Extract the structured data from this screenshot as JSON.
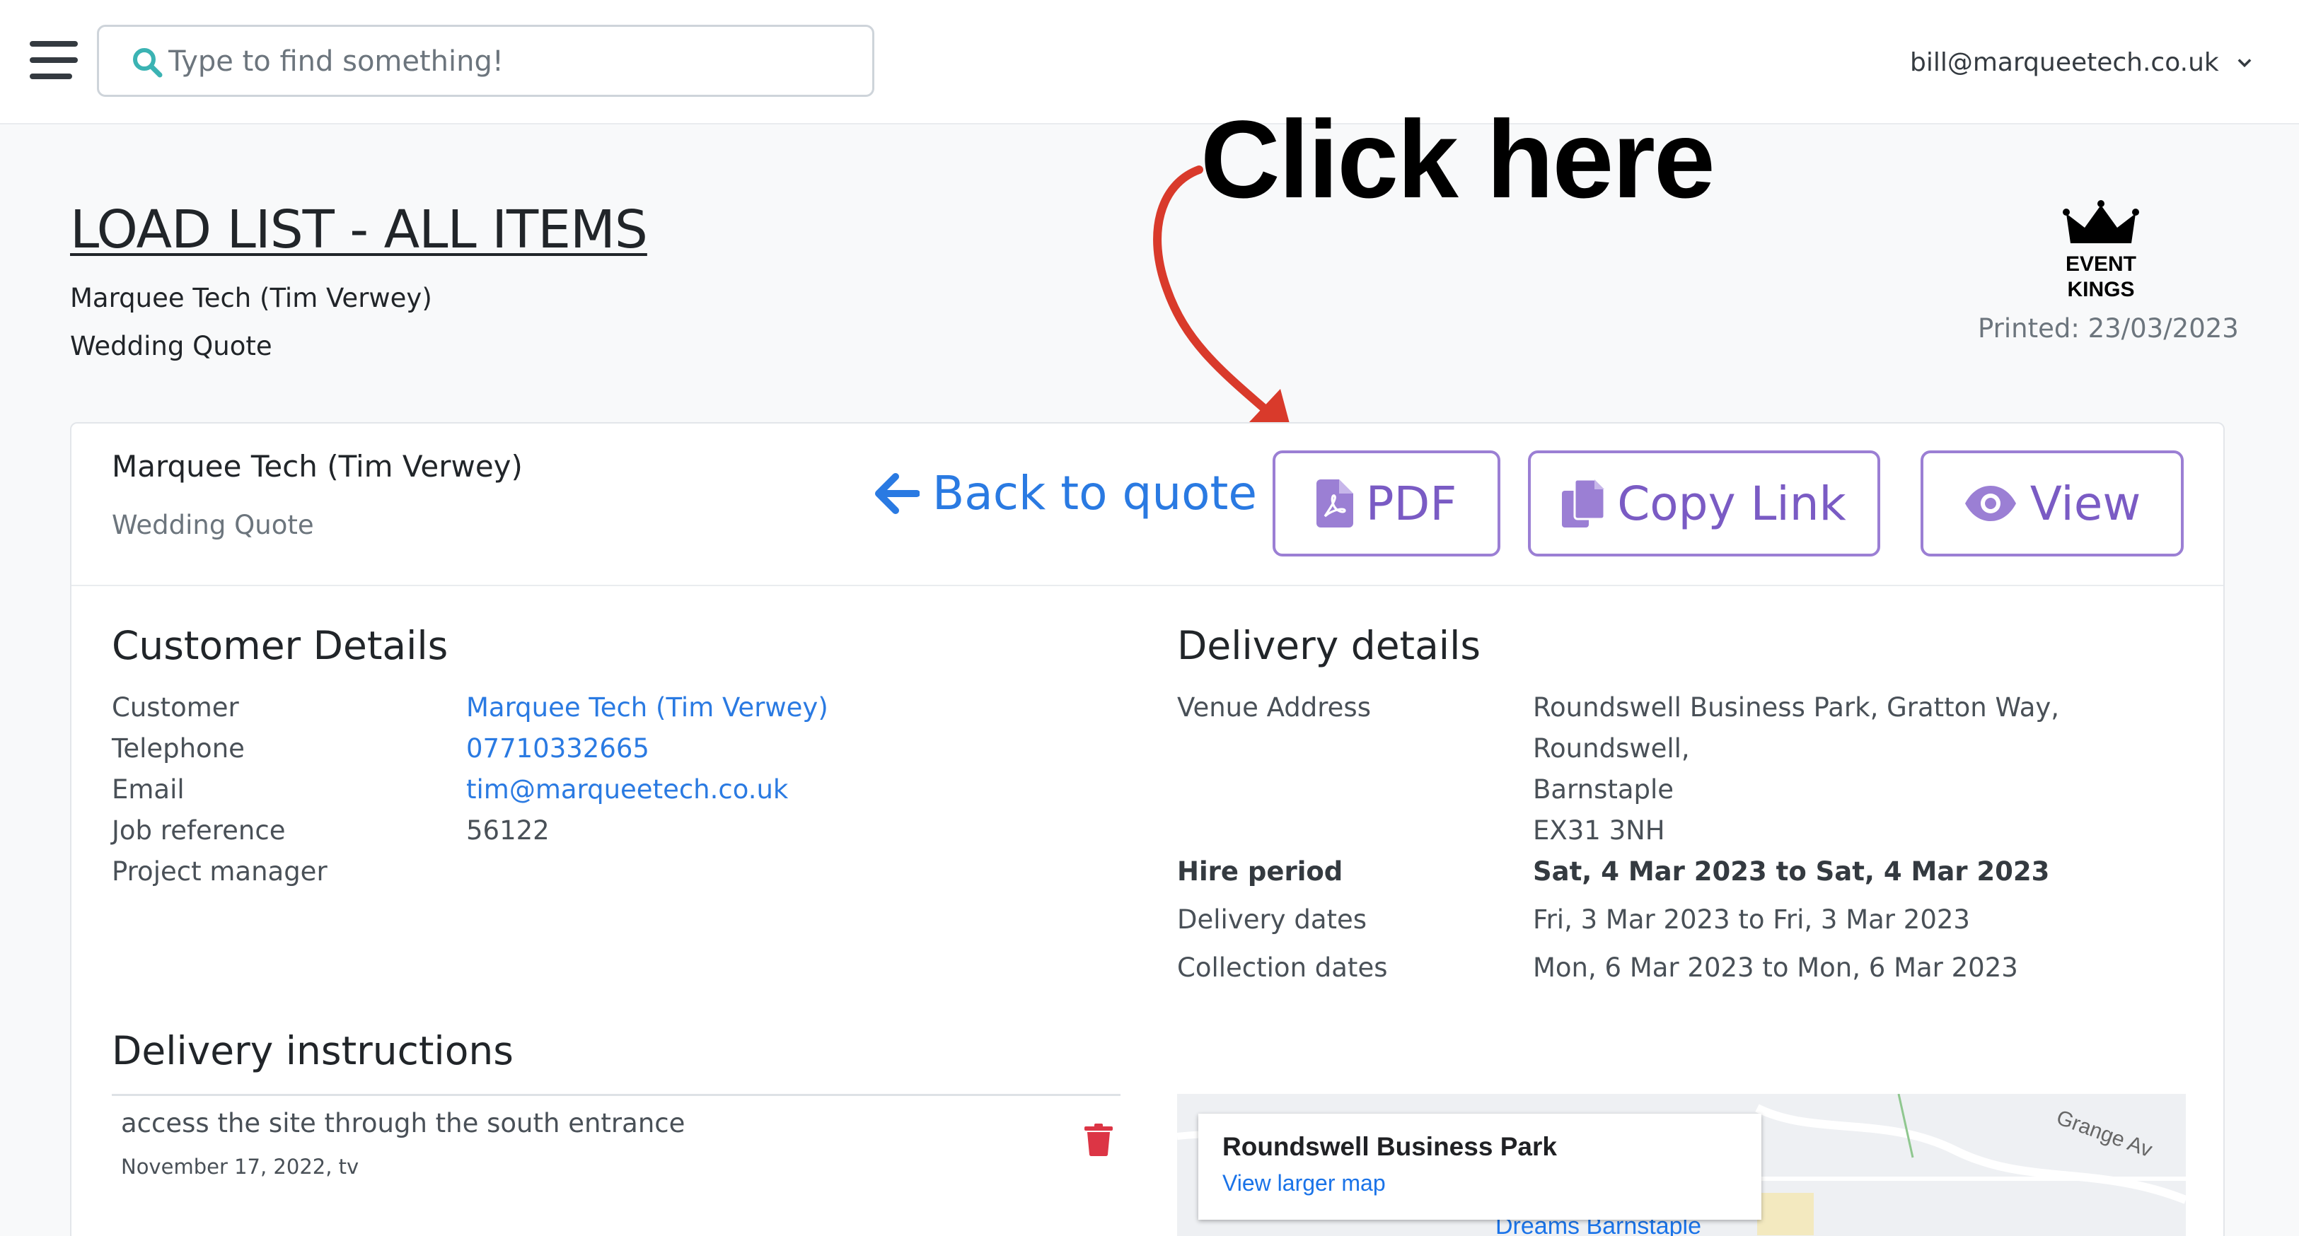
{
  "topbar": {
    "search_placeholder": "Type to find something!",
    "account_email": "bill@marqueetech.co.uk"
  },
  "header": {
    "title": "LOAD LIST - ALL ITEMS",
    "customer_line": "Marquee Tech (Tim Verwey)",
    "quote_line": "Wedding Quote",
    "printed": "Printed: 23/03/2023",
    "logo_line1": "EVENT",
    "logo_line2": "KINGS"
  },
  "annotation": {
    "text": "Click here",
    "color": "#d93a2b"
  },
  "card": {
    "title": "Marquee Tech (Tim Verwey)",
    "subtitle": "Wedding Quote",
    "back_label": "Back to quote",
    "pdf_label": "PDF",
    "copy_label": "Copy Link",
    "view_label": "View"
  },
  "customer": {
    "heading": "Customer Details",
    "rows": [
      {
        "label": "Customer",
        "value": "Marquee Tech (Tim Verwey)"
      },
      {
        "label": "Telephone",
        "value": "07710332665"
      },
      {
        "label": "Email",
        "value": "tim@marqueetech.co.uk"
      },
      {
        "label": "Job reference",
        "value": "56122"
      },
      {
        "label": "Project manager",
        "value": ""
      }
    ]
  },
  "delivery": {
    "heading": "Delivery details",
    "venue_label": "Venue Address",
    "venue_lines": [
      "Roundswell Business Park, Gratton Way,",
      "Roundswell,",
      "Barnstaple",
      "EX31 3NH"
    ],
    "hire_label": "Hire period",
    "hire_value": "Sat, 4 Mar 2023 to Sat, 4 Mar 2023",
    "delivery_label": "Delivery dates",
    "delivery_value": "Fri, 3 Mar 2023 to Fri, 3 Mar 2023",
    "collection_label": "Collection dates",
    "collection_value": "Mon, 6 Mar 2023 to Mon, 6 Mar 2023"
  },
  "instructions": {
    "heading": "Delivery instructions",
    "note": "access the site through the south entrance",
    "meta": "November 17, 2022, tv"
  },
  "map": {
    "title": "Roundswell Business Park",
    "link": "View larger map",
    "road": "Grange Av",
    "place": "Dreams Barnstaple"
  },
  "colors": {
    "accent": "#2a7ae2",
    "button_border": "#9b7fd4",
    "button_text": "#7a5bc4",
    "trash": "#dc3545"
  }
}
